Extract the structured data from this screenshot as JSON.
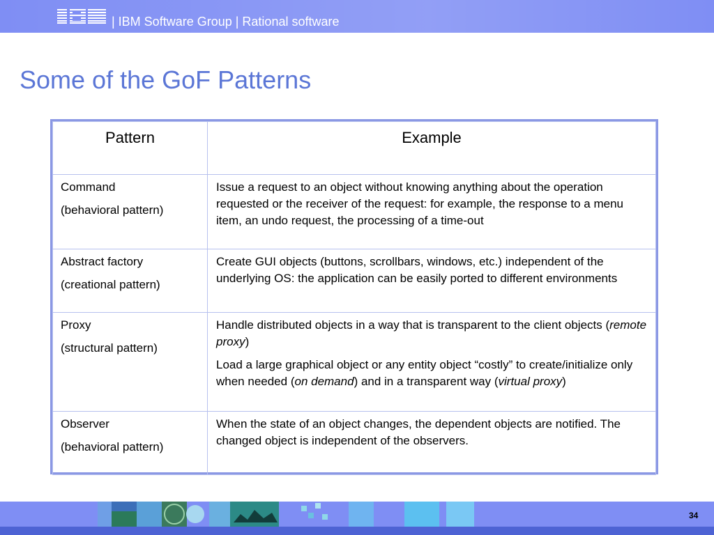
{
  "header": {
    "logo_text": "IBM",
    "text": "| IBM Software Group | Rational software"
  },
  "title": "Some of the GoF Patterns",
  "table": {
    "columns": [
      "Pattern",
      "Example"
    ],
    "rows": [
      {
        "pattern": "Command",
        "category": "(behavioral pattern)",
        "example_parts": [
          "Issue a request to an object without knowing anything about the operation requested or the receiver of the request: for example, the response to a menu item, an undo request, the processing of a time-out"
        ]
      },
      {
        "pattern": "Abstract factory",
        "category": "(creational pattern)",
        "example_parts": [
          "Create GUI objects (buttons, scrollbars, windows, etc.) independent of the underlying OS: the application can be easily ported to different environments"
        ]
      },
      {
        "pattern": "Proxy",
        "category": "(structural pattern)",
        "example_parts": [
          "Handle distributed objects in a way that is transparent to the client objects (",
          "remote proxy",
          ")",
          "Load a large graphical object or any entity object “costly” to create/initialize only when needed (",
          "on demand",
          ") and in a transparent way (",
          "virtual proxy",
          ")"
        ]
      },
      {
        "pattern": "Observer",
        "category": "(behavioral pattern)",
        "example_parts": [
          "When the state of an object changes, the dependent objects are notified. The changed object is independent of the observers."
        ]
      }
    ]
  },
  "footer": {
    "page_number": "34"
  },
  "colors": {
    "header_bg": "#7f8ef4",
    "title": "#5b76d6",
    "table_border": "#8b98e4",
    "footer_bottom": "#4d63d4"
  }
}
